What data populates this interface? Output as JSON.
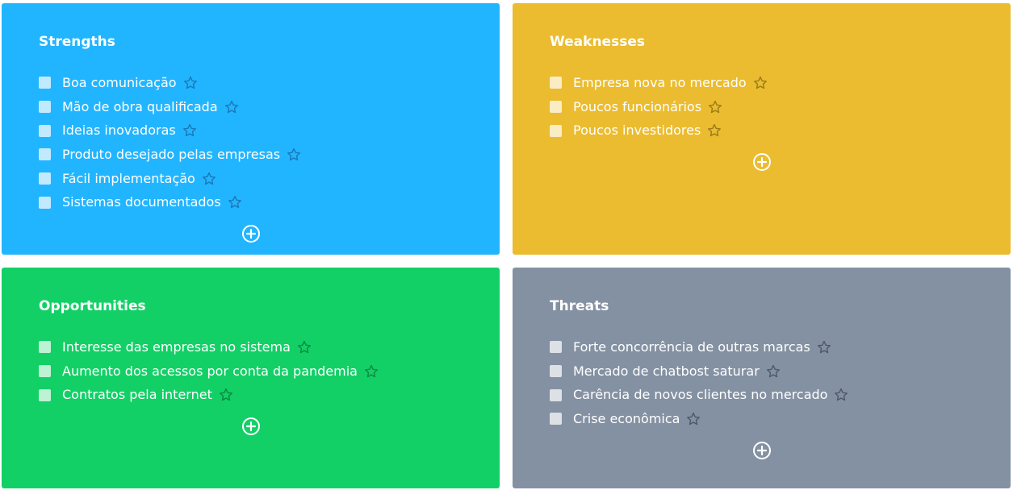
{
  "colors": {
    "strengths": "#22b5ff",
    "weaknesses": "#ebbc2f",
    "opportunities": "#13d066",
    "threats": "#8491a3",
    "star_strengths": "#1a78b8",
    "star_weaknesses": "#9a7a18",
    "star_opportunities": "#0b8a41",
    "star_threats": "#4d5868"
  },
  "icons": {
    "star": "star-outline-icon",
    "add": "plus-circle-icon"
  },
  "strengths": {
    "title": "Strengths",
    "items": [
      "Boa comunicação",
      "Mão de obra qualificada",
      "Ideias inovadoras",
      "Produto desejado pelas empresas",
      "Fácil implementação",
      "Sistemas documentados"
    ]
  },
  "weaknesses": {
    "title": "Weaknesses",
    "items": [
      "Empresa nova no mercado",
      "Poucos funcionários",
      "Poucos investidores"
    ]
  },
  "opportunities": {
    "title": "Opportunities",
    "items": [
      "Interesse das empresas no sistema",
      "Aumento dos acessos por conta da pandemia",
      "Contratos pela internet"
    ]
  },
  "threats": {
    "title": "Threats",
    "items": [
      "Forte concorrência de outras marcas",
      "Mercado de chatbost saturar",
      "Carência de novos clientes no mercado",
      "Crise econômica"
    ]
  }
}
